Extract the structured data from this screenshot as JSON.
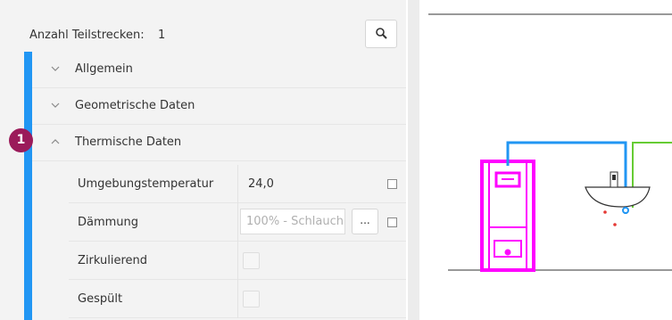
{
  "header": {
    "label": "Anzahl Teilstrecken:",
    "count": "1",
    "search_icon": "search-icon"
  },
  "sections": [
    {
      "label": "Allgemein",
      "expanded": false
    },
    {
      "label": "Geometrische Daten",
      "expanded": false
    },
    {
      "label": "Thermische Daten",
      "expanded": true
    }
  ],
  "properties": {
    "umgebung": {
      "label": "Umgebungstemperatur",
      "value": "24,0"
    },
    "daemmung": {
      "label": "Dämmung",
      "value": "100% - Schlauch",
      "button": "..."
    },
    "zirk": {
      "label": "Zirkulierend"
    },
    "gespuelt": {
      "label": "Gespült"
    }
  },
  "badge": "1",
  "colors": {
    "accent": "#2196f3",
    "badge": "#9b1b5a",
    "pipe_blue": "#2196f3",
    "pipe_green": "#66cc33",
    "wc": "#ff00ff"
  }
}
